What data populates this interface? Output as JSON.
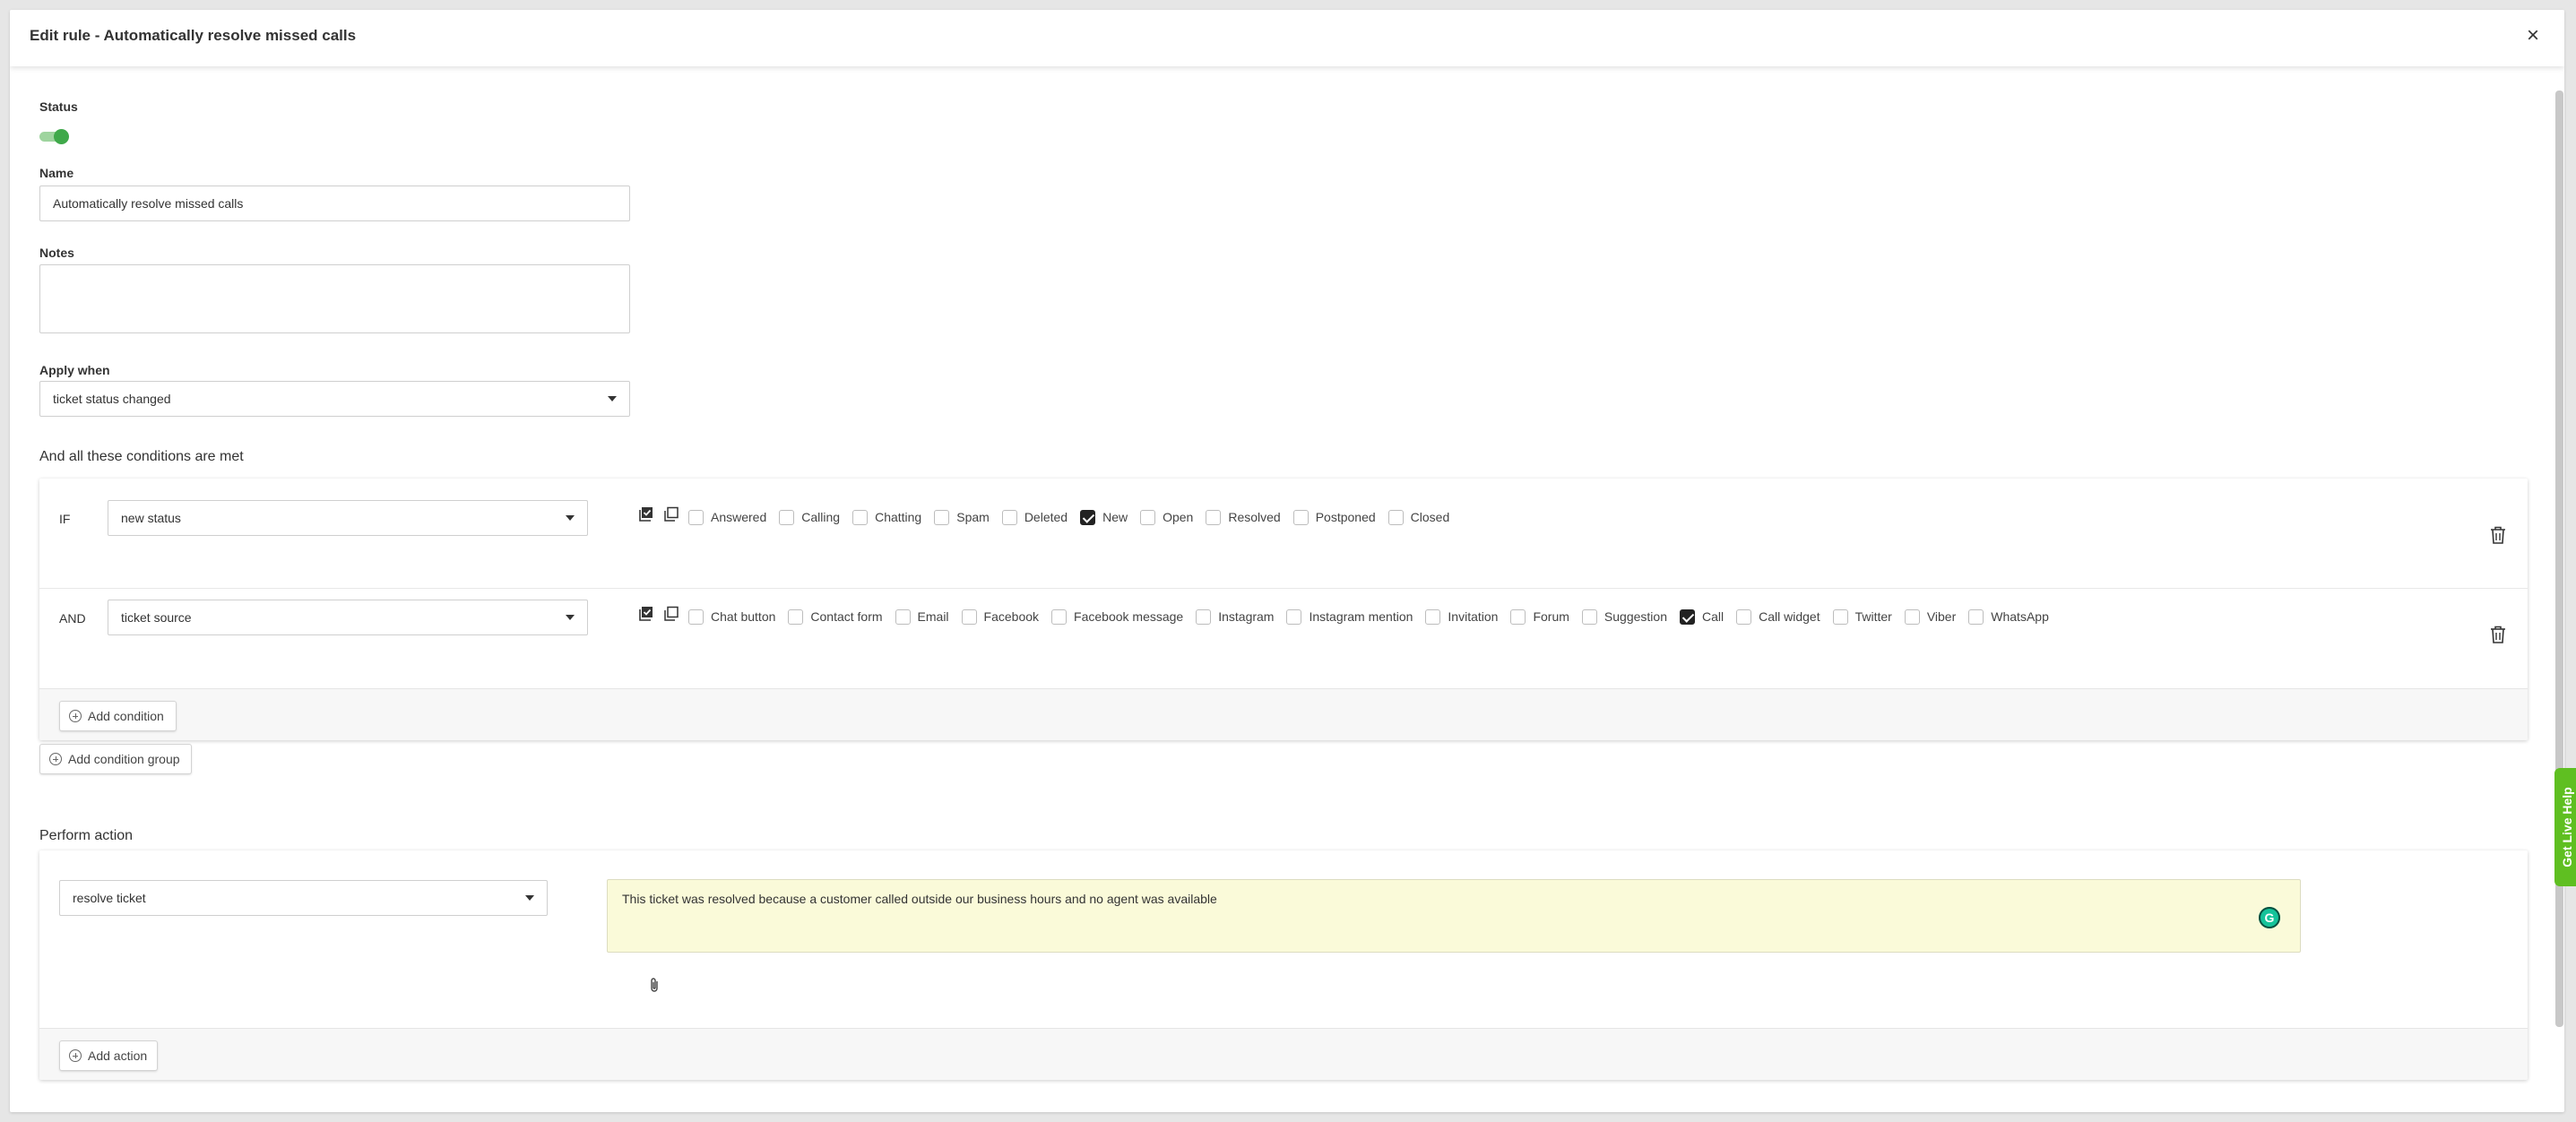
{
  "modal": {
    "title": "Edit rule - Automatically resolve missed calls",
    "close_glyph": "×"
  },
  "form": {
    "status_label": "Status",
    "status_on": true,
    "name_label": "Name",
    "name_value": "Automatically resolve missed calls",
    "notes_label": "Notes",
    "notes_value": "",
    "apply_when_label": "Apply when",
    "apply_when_value": "ticket status changed"
  },
  "conditions": {
    "section_title": "And all these conditions are met",
    "rows": [
      {
        "keyword": "IF",
        "field": "new status",
        "options": [
          {
            "label": "Answered",
            "checked": false
          },
          {
            "label": "Calling",
            "checked": false
          },
          {
            "label": "Chatting",
            "checked": false
          },
          {
            "label": "Spam",
            "checked": false
          },
          {
            "label": "Deleted",
            "checked": false
          },
          {
            "label": "New",
            "checked": true
          },
          {
            "label": "Open",
            "checked": false
          },
          {
            "label": "Resolved",
            "checked": false
          },
          {
            "label": "Postponed",
            "checked": false
          },
          {
            "label": "Closed",
            "checked": false
          }
        ]
      },
      {
        "keyword": "AND",
        "field": "ticket source",
        "options": [
          {
            "label": "Chat button",
            "checked": false
          },
          {
            "label": "Contact form",
            "checked": false
          },
          {
            "label": "Email",
            "checked": false
          },
          {
            "label": "Facebook",
            "checked": false
          },
          {
            "label": "Facebook message",
            "checked": false
          },
          {
            "label": "Instagram",
            "checked": false
          },
          {
            "label": "Instagram mention",
            "checked": false
          },
          {
            "label": "Invitation",
            "checked": false
          },
          {
            "label": "Forum",
            "checked": false
          },
          {
            "label": "Suggestion",
            "checked": false
          },
          {
            "label": "Call",
            "checked": true
          },
          {
            "label": "Call widget",
            "checked": false
          },
          {
            "label": "Twitter",
            "checked": false
          },
          {
            "label": "Viber",
            "checked": false
          },
          {
            "label": "WhatsApp",
            "checked": false
          }
        ]
      }
    ],
    "add_condition_label": "Add condition",
    "add_condition_group_label": "Add condition group"
  },
  "actions": {
    "section_title": "Perform action",
    "action_value": "resolve ticket",
    "message": "This ticket was resolved because a customer called outside our business hours and no agent was available",
    "add_action_label": "Add action",
    "grammarly_glyph": "G"
  },
  "live_help": {
    "label": "Get Live Help",
    "color": "#5fbf21"
  }
}
